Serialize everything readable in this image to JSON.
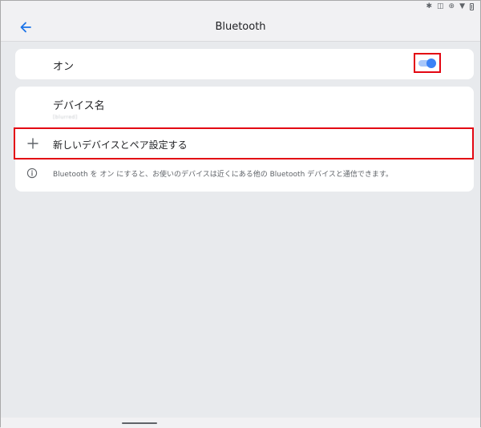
{
  "app_bar": {
    "title": "Bluetooth",
    "back_icon": "arrow-back-icon"
  },
  "status_bar": {
    "icons": [
      "bluetooth-icon",
      "vibrate-icon",
      "location-icon",
      "wifi-icon",
      "battery-icon"
    ]
  },
  "bluetooth_toggle": {
    "label": "オン",
    "state": "on"
  },
  "device_name": {
    "title": "デバイス名",
    "value": "[blurred]"
  },
  "pair_new_device": {
    "label": "新しいデバイスとペア設定する",
    "icon": "plus-icon"
  },
  "info": {
    "text": "Bluetooth を オン にすると、お使いのデバイスは近くにある他の Bluetooth デバイスと通信できます。",
    "icon": "info-icon"
  },
  "colors": {
    "accent": "#3b82f6",
    "highlight": "#e30613",
    "background": "#e8eaed",
    "card": "#ffffff"
  }
}
